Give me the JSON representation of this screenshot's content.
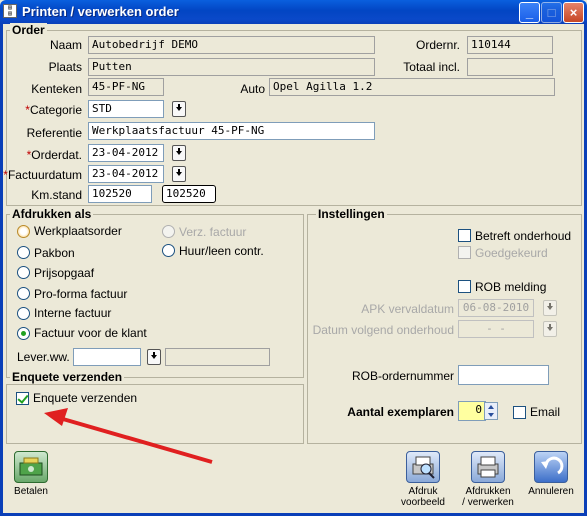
{
  "window": {
    "title": "Printen / verwerken order",
    "icon": "app-report-icon"
  },
  "order": {
    "section_title": "Order",
    "naam_label": "Naam",
    "naam": "Autobedrijf DEMO",
    "plaats_label": "Plaats",
    "plaats": "Putten",
    "kenteken_label": "Kenteken",
    "kenteken": "45-PF-NG",
    "auto_label": "Auto",
    "auto": "Opel Agilla 1.2",
    "categorie_label": "Categorie",
    "categorie": "STD",
    "referentie_label": "Referentie",
    "referentie": "Werkplaatsfactuur 45-PF-NG",
    "orderdat_label": "Orderdat.",
    "orderdat": "23-04-2012",
    "factuurdatum_label": "Factuurdatum",
    "factuurdatum": "23-04-2012",
    "kmstand_label": "Km.stand",
    "kmstand": "102520",
    "kmstand_display": "102520",
    "ordernr_label": "Ordernr.",
    "ordernr": "110144",
    "totaal_label": "Totaal incl.",
    "totaal": ""
  },
  "afdrukken": {
    "section_title": "Afdrukken als",
    "options": [
      "Werkplaatsorder",
      "Pakbon",
      "Prijsopgaaf",
      "Pro-forma factuur",
      "Interne factuur",
      "Factuur voor de klant"
    ],
    "selected": "Factuur voor de klant",
    "verz_factuur": "Verz. factuur",
    "huur": "Huur/leen contr.",
    "leverww_label": "Lever.ww.",
    "leverww": ""
  },
  "enquete": {
    "section_title": "Enquete verzenden",
    "checkbox_label": "Enquete verzenden",
    "checked": true
  },
  "instellingen": {
    "section_title": "Instellingen",
    "betreft_onderhoud": "Betreft onderhoud",
    "goedgekeurd": "Goedgekeurd",
    "rob_melding": "ROB melding",
    "apk_label": "APK vervaldatum",
    "apk": "06-08-2010",
    "datum_label": "Datum volgend onderhoud",
    "datum": "-  -",
    "rob_nummer_label": "ROB-ordernummer",
    "rob_nummer": "",
    "exemplaren_label": "Aantal exemplaren",
    "exemplaren": "0",
    "email_label": "Email"
  },
  "toolbar": {
    "betalen": "Betalen",
    "afdruk_voorbeeld_1": "Afdruk",
    "afdruk_voorbeeld_2": "voorbeeld",
    "afdrukken_1": "Afdrukken",
    "afdrukken_2": "/ verwerken",
    "annuleren": "Annuleren"
  },
  "colors": {
    "titlebar": "#0a49c9",
    "arrow": "#e02020",
    "required": "#c00000"
  }
}
